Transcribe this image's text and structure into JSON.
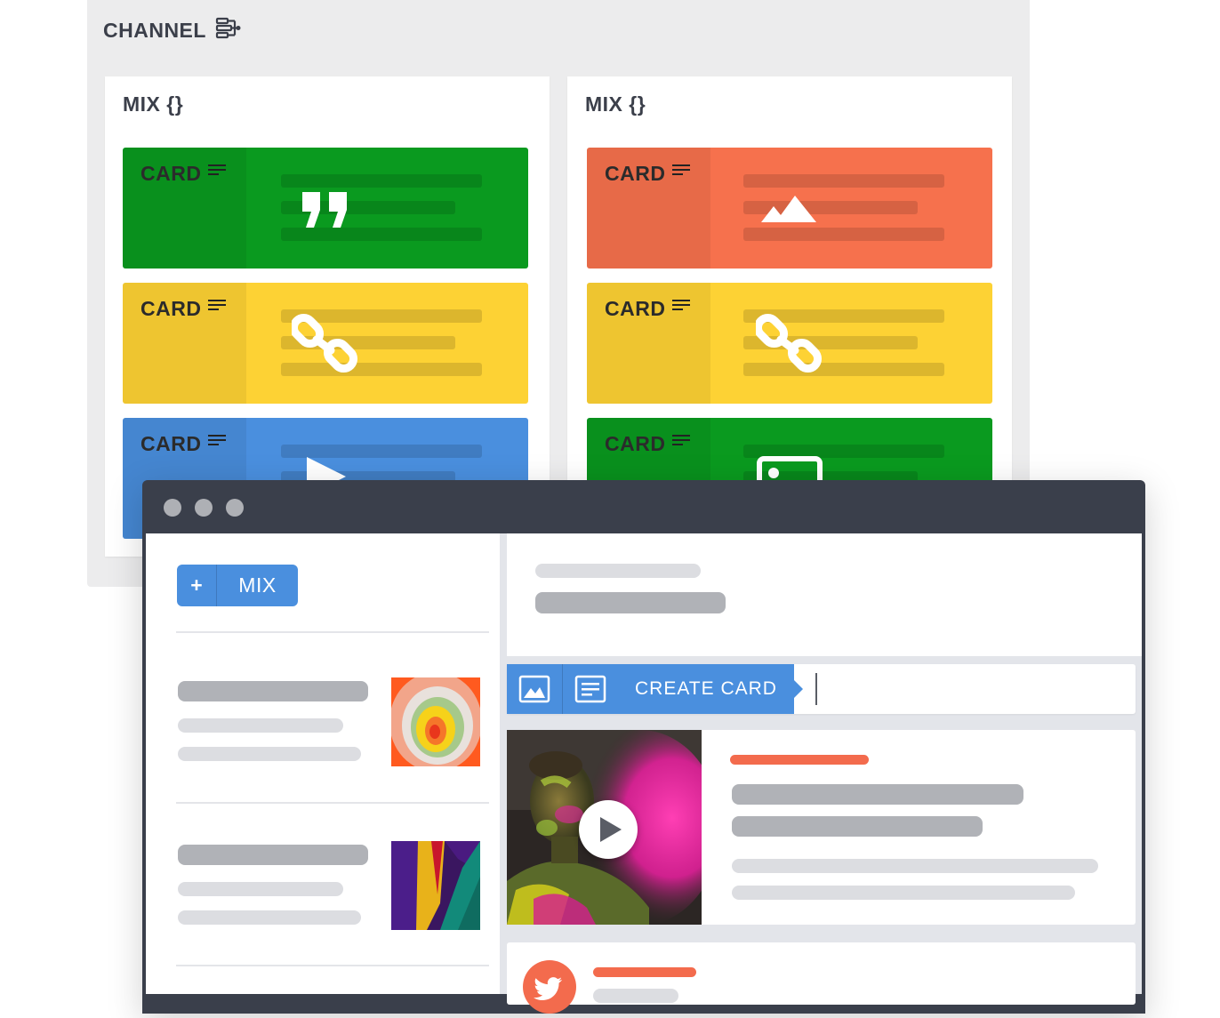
{
  "channel": {
    "title": "CHANNEL",
    "icon": "channel-structure-icon",
    "columns": [
      {
        "title": "MIX {}",
        "cards": [
          {
            "label": "CARD",
            "type_icon": "quote-icon",
            "color": "#0a9a1f"
          },
          {
            "label": "CARD",
            "type_icon": "link-icon",
            "color": "#fdd234"
          },
          {
            "label": "CARD",
            "type_icon": "play-icon",
            "color": "#4a8fde"
          }
        ]
      },
      {
        "title": "MIX {}",
        "cards": [
          {
            "label": "CARD",
            "type_icon": "mountain-icon",
            "color": "#f6714d"
          },
          {
            "label": "CARD",
            "type_icon": "link-icon",
            "color": "#fdd234"
          },
          {
            "label": "CARD",
            "type_icon": "image-icon",
            "color": "#0a9a1f"
          }
        ]
      }
    ]
  },
  "browser": {
    "window_dots": [
      "close-dot",
      "minimize-dot",
      "zoom-dot"
    ],
    "sidebar": {
      "add_mix_button": {
        "plus": "+",
        "label": "MIX"
      }
    },
    "toolbar": {
      "image_button_icon": "image-icon",
      "text_button_icon": "text-icon",
      "create_card_label": "CREATE CARD"
    },
    "media_card": {
      "play_icon": "play-icon"
    },
    "social_card": {
      "icon": "twitter-icon"
    }
  },
  "colors": {
    "green": "#0a9a1f",
    "yellow": "#fdd234",
    "blue": "#4a8fde",
    "orange": "#f6714d",
    "window_chrome": "#3a3f4b",
    "accent_bar": "#f36b4d"
  }
}
